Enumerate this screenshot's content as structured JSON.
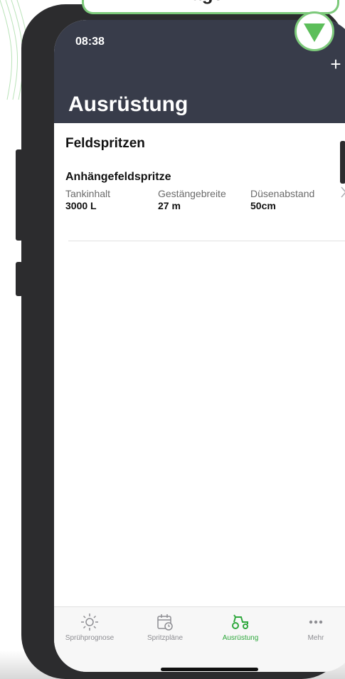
{
  "banner": {
    "text": "lagen"
  },
  "status_bar": {
    "time": "08:38"
  },
  "header": {
    "title": "Ausrüstung",
    "add_label": "+"
  },
  "section": {
    "title": "Feldspritzen"
  },
  "equipment": [
    {
      "name": "Anhängefeldspritze",
      "fields": [
        {
          "label": "Tankinhalt",
          "value": "3000 L"
        },
        {
          "label": "Gestängebreite",
          "value": "27 m"
        },
        {
          "label": "Düsenabstand",
          "value": "50cm"
        }
      ]
    }
  ],
  "tabs": [
    {
      "label": "Sprühprognose",
      "icon": "sun-icon",
      "active": false
    },
    {
      "label": "Spritzpläne",
      "icon": "calendar-clock-icon",
      "active": false
    },
    {
      "label": "Ausrüstung",
      "icon": "tractor-icon",
      "active": true
    },
    {
      "label": "Mehr",
      "icon": "more-dots-icon",
      "active": false
    }
  ],
  "colors": {
    "header_bg": "#383c4a",
    "accent_green": "#2fa83d",
    "highlight_green": "#7cc97a"
  }
}
